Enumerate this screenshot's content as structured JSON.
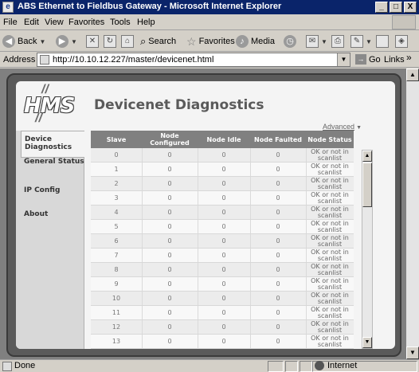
{
  "window": {
    "title": "ABS Ethernet to Fieldbus Gateway - Microsoft Internet Explorer",
    "controls": [
      "_",
      "□",
      "X"
    ]
  },
  "menu": [
    "File",
    "Edit",
    "View",
    "Favorites",
    "Tools",
    "Help"
  ],
  "toolbar": {
    "back": "Back",
    "search": "Search",
    "favorites": "Favorites",
    "media": "Media"
  },
  "address": {
    "label": "Address",
    "url": "http://10.10.12.227/master/devicenet.html",
    "go": "Go",
    "links": "Links",
    "more": "»"
  },
  "logo": {
    "text": "HMS"
  },
  "nav": [
    {
      "label": "Device Diagnostics",
      "active": true
    },
    {
      "label": "General Status",
      "active": false
    },
    {
      "label": "IP Config",
      "active": false
    },
    {
      "label": "About",
      "active": false
    }
  ],
  "page": {
    "title": "Devicenet Diagnostics",
    "advanced": "Advanced",
    "advanced_icon": "▼"
  },
  "table": {
    "headers": [
      "Slave",
      "Node Configured",
      "Node Idle",
      "Node Faulted",
      "Node Status"
    ],
    "rows": [
      {
        "slave": "0",
        "configured": "0",
        "idle": "0",
        "faulted": "0",
        "status": "OK or not in scanlist"
      },
      {
        "slave": "1",
        "configured": "0",
        "idle": "0",
        "faulted": "0",
        "status": "OK or not in scanlist"
      },
      {
        "slave": "2",
        "configured": "0",
        "idle": "0",
        "faulted": "0",
        "status": "OK or not in scanlist"
      },
      {
        "slave": "3",
        "configured": "0",
        "idle": "0",
        "faulted": "0",
        "status": "OK or not in scanlist"
      },
      {
        "slave": "4",
        "configured": "0",
        "idle": "0",
        "faulted": "0",
        "status": "OK or not in scanlist"
      },
      {
        "slave": "5",
        "configured": "0",
        "idle": "0",
        "faulted": "0",
        "status": "OK or not in scanlist"
      },
      {
        "slave": "6",
        "configured": "0",
        "idle": "0",
        "faulted": "0",
        "status": "OK or not in scanlist"
      },
      {
        "slave": "7",
        "configured": "0",
        "idle": "0",
        "faulted": "0",
        "status": "OK or not in scanlist"
      },
      {
        "slave": "8",
        "configured": "0",
        "idle": "0",
        "faulted": "0",
        "status": "OK or not in scanlist"
      },
      {
        "slave": "9",
        "configured": "0",
        "idle": "0",
        "faulted": "0",
        "status": "OK or not in scanlist"
      },
      {
        "slave": "10",
        "configured": "0",
        "idle": "0",
        "faulted": "0",
        "status": "OK or not in scanlist"
      },
      {
        "slave": "11",
        "configured": "0",
        "idle": "0",
        "faulted": "0",
        "status": "OK or not in scanlist"
      },
      {
        "slave": "12",
        "configured": "0",
        "idle": "0",
        "faulted": "0",
        "status": "OK or not in scanlist"
      },
      {
        "slave": "13",
        "configured": "0",
        "idle": "0",
        "faulted": "0",
        "status": "OK or not in scanlist"
      }
    ]
  },
  "statusbar": {
    "text": "Done",
    "zone": "Internet"
  }
}
